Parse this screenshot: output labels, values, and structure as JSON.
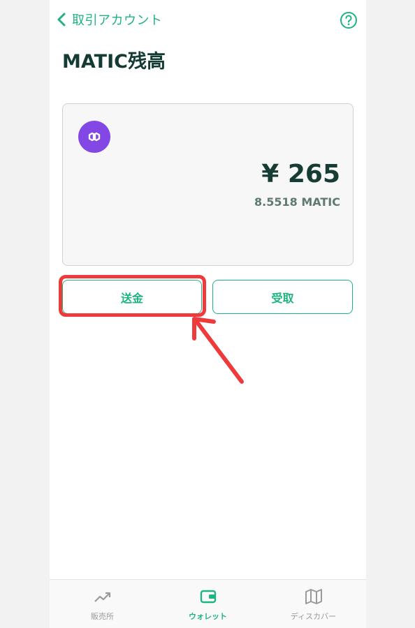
{
  "nav": {
    "back_label": "取引アカウント",
    "help_icon": "question-circle-icon"
  },
  "page": {
    "title": "MATIC残高"
  },
  "balance": {
    "coin_icon": "polygon-matic-logo",
    "fiat_value": "¥ 265",
    "crypto_value": "8.5518 MATIC"
  },
  "actions": {
    "send_label": "送金",
    "receive_label": "受取"
  },
  "annotation": {
    "highlight_color": "#ee3a3a"
  },
  "tabbar": {
    "items": [
      {
        "label": "販売所",
        "icon": "trend-up-icon",
        "active": false
      },
      {
        "label": "ウォレット",
        "icon": "wallet-icon",
        "active": true
      },
      {
        "label": "ディスカバー",
        "icon": "map-icon",
        "active": false
      }
    ]
  },
  "colors": {
    "accent": "#1fb47f",
    "title_text": "#133b33",
    "coin_purple": "#8247e5"
  }
}
